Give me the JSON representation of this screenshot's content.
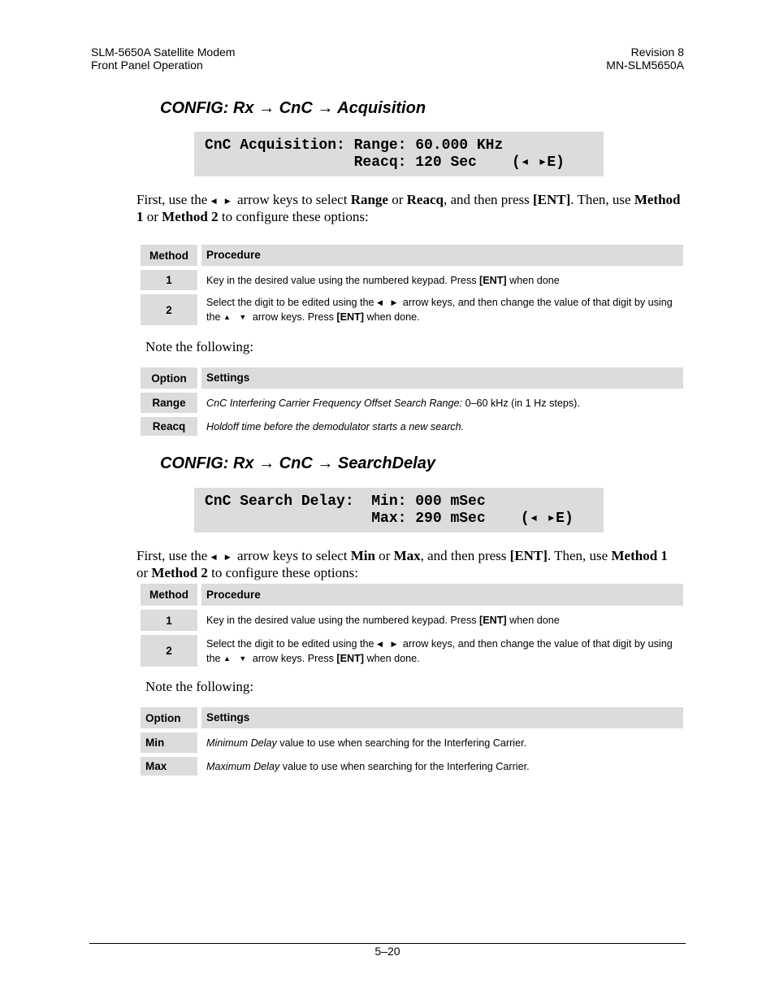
{
  "header": {
    "left1": "SLM-5650A Satellite Modem",
    "left2": "Front Panel Operation",
    "right1": "Revision 8",
    "right2": "MN-SLM5650A"
  },
  "icons": {
    "left_right": "◀ ▶",
    "up_down": "▲ ▼"
  },
  "section1": {
    "title": "CONFIG: Rx → CnC → Acquisition",
    "lcd": {
      "line1": "CnC Acquisition: Range: 60.000 KHz",
      "line2": "                 Reacq: 120 Sec    (◂ ▸E)"
    },
    "intro": [
      {
        "t": "First, use the "
      },
      {
        "t": "◀ ▶",
        "a": 1
      },
      {
        "t": " arrow keys to select "
      },
      {
        "t": "Range",
        "b": 1
      },
      {
        "t": " or "
      },
      {
        "t": "Reacq",
        "b": 1
      },
      {
        "t": ", and then press "
      },
      {
        "t": "[ENT]",
        "b": 1
      },
      {
        "t": ". Then, use "
      },
      {
        "t": "Method 1",
        "b": 1
      },
      {
        "t": " or "
      },
      {
        "t": "Method 2",
        "b": 1
      },
      {
        "t": " to configure these options:"
      }
    ],
    "method_table": {
      "headers": [
        "Method",
        "Procedure"
      ],
      "rows": [
        {
          "key": "1",
          "text": [
            {
              "t": "Key in the desired value using the numbered keypad. Press "
            },
            {
              "t": "[ENT]",
              "b": 1
            },
            {
              "t": " when done"
            }
          ]
        },
        {
          "key": "2",
          "text": [
            {
              "t": "Select the digit to be edited using the "
            },
            {
              "t": "◀ ▶",
              "a": 1
            },
            {
              "t": " arrow keys, and then change the value of that digit by using the "
            },
            {
              "t": "▲ ▼",
              "a": 1
            },
            {
              "t": " arrow keys. Press "
            },
            {
              "t": "[ENT]",
              "b": 1
            },
            {
              "t": " when done."
            }
          ]
        }
      ]
    },
    "note": "Note the following:",
    "option_table": {
      "headers": [
        "Option",
        "Settings"
      ],
      "rows": [
        {
          "key": "Range",
          "text": [
            {
              "t": "CnC Interfering Carrier Frequency Offset Search Range:",
              "i": 1
            },
            {
              "t": " 0–60 kHz (in 1 Hz steps)."
            }
          ]
        },
        {
          "key": "Reacq",
          "text": [
            {
              "t": "Holdoff time before the demodulator starts a new search.",
              "i": 1
            }
          ]
        }
      ]
    }
  },
  "section2": {
    "title": "CONFIG: Rx → CnC → SearchDelay",
    "lcd": {
      "line1": "CnC Search Delay:  Min: 000 mSec",
      "line2": "                   Max: 290 mSec    (◂ ▸E)"
    },
    "intro": [
      {
        "t": "First, use the "
      },
      {
        "t": "◀ ▶",
        "a": 1
      },
      {
        "t": " arrow keys to select "
      },
      {
        "t": "Min",
        "b": 1
      },
      {
        "t": " or "
      },
      {
        "t": "Max",
        "b": 1
      },
      {
        "t": ", and then press "
      },
      {
        "t": "[ENT]",
        "b": 1
      },
      {
        "t": ". Then, use "
      },
      {
        "t": "Method 1",
        "b": 1
      },
      {
        "t": " or "
      },
      {
        "t": "Method 2",
        "b": 1
      },
      {
        "t": " to configure these options:"
      }
    ],
    "method_table": {
      "headers": [
        "Method",
        "Procedure"
      ],
      "rows": [
        {
          "key": "1",
          "text": [
            {
              "t": "Key in the desired value using the numbered keypad. Press "
            },
            {
              "t": "[ENT]",
              "b": 1
            },
            {
              "t": " when done"
            }
          ]
        },
        {
          "key": "2",
          "text": [
            {
              "t": "Select the digit to be edited using the "
            },
            {
              "t": "◀ ▶",
              "a": 1
            },
            {
              "t": " arrow keys, and then change the value of that digit by using the "
            },
            {
              "t": "▲ ▼",
              "a": 1
            },
            {
              "t": " arrow keys. Press "
            },
            {
              "t": "[ENT]",
              "b": 1
            },
            {
              "t": " when done."
            }
          ]
        }
      ]
    },
    "note": "Note the following:",
    "option_table": {
      "headers": [
        "Option",
        "Settings"
      ],
      "rows": [
        {
          "key": "Min",
          "text": [
            {
              "t": "Minimum Delay",
              "i": 1
            },
            {
              "t": " value to use when searching for the Interfering Carrier."
            }
          ]
        },
        {
          "key": "Max",
          "text": [
            {
              "t": "Maximum Delay",
              "i": 1
            },
            {
              "t": " value to use when searching for the Interfering Carrier."
            }
          ]
        }
      ]
    }
  },
  "footer": {
    "page_number": "5–20"
  }
}
